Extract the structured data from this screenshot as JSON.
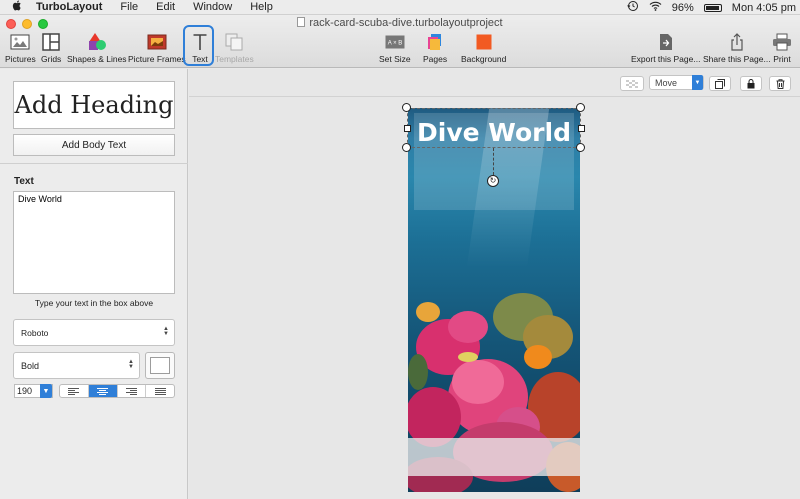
{
  "menubar": {
    "app_name": "TurboLayout",
    "items": [
      "File",
      "Edit",
      "Window",
      "Help"
    ],
    "battery": "96%",
    "clock": "Mon 4:05 pm"
  },
  "window": {
    "title": "rack-card-scuba-dive.turbolayoutproject"
  },
  "toolbar": {
    "pictures": "Pictures",
    "grids": "Grids",
    "shapes": "Shapes & Lines",
    "frames": "Picture Frames",
    "text": "Text",
    "templates": "Templates",
    "set_size": "Set Size",
    "pages": "Pages",
    "background": "Background",
    "export": "Export this Page...",
    "share": "Share this Page...",
    "print": "Print",
    "background_color": "#f25a22"
  },
  "panel": {
    "add_heading": "Add Heading",
    "add_body": "Add Body Text",
    "text_label": "Text",
    "text_value": "Dive World",
    "hint": "Type your text in the box above",
    "font": "Roboto",
    "weight": "Bold",
    "size": "190"
  },
  "canvas": {
    "move_mode": "Move",
    "card_title": "Dive World"
  },
  "colors": {
    "accent": "#2f7fd8"
  }
}
